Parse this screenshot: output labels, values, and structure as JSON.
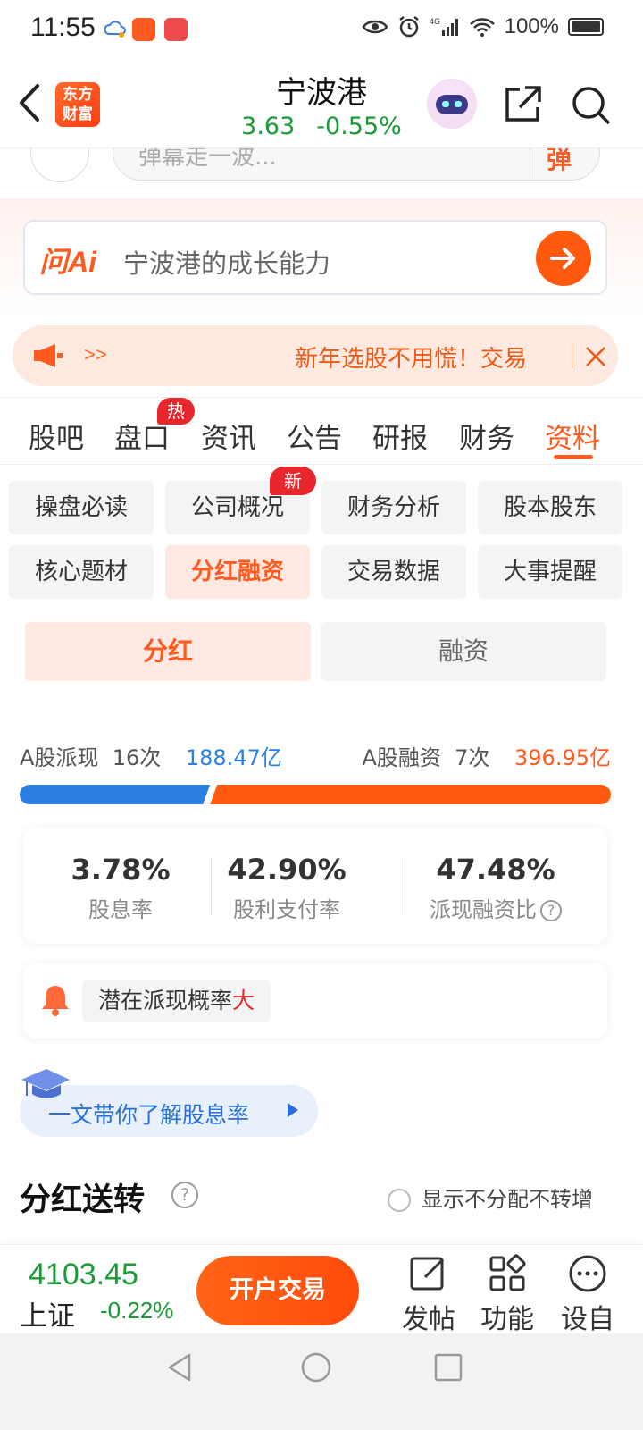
{
  "status_bar": {
    "time": "11:55",
    "battery": "100%"
  },
  "header": {
    "title": "宁波港",
    "price": "3.63",
    "change": "-0.55%",
    "logo_text": "东方\n财富"
  },
  "danmaku": {
    "placeholder": "弹幕走一波..."
  },
  "ai": {
    "logo": "问Ai",
    "query": "宁波港的成长能力"
  },
  "notice": {
    "arrows": ">>",
    "text": "新年选股不用慌！交易"
  },
  "tabs": [
    {
      "label": "股吧"
    },
    {
      "label": "盘口"
    },
    {
      "label": "资讯"
    },
    {
      "label": "公告"
    },
    {
      "label": "研报"
    },
    {
      "label": "财务"
    },
    {
      "label": "资料"
    }
  ],
  "tab_badge_hot": "热",
  "subnav": [
    {
      "label": "操盘必读"
    },
    {
      "label": "公司概况"
    },
    {
      "label": "财务分析"
    },
    {
      "label": "股本股东"
    },
    {
      "label": "核心题材"
    },
    {
      "label": "分红融资"
    },
    {
      "label": "交易数据"
    },
    {
      "label": "大事提醒"
    }
  ],
  "subnav_badge_new": "新",
  "segment": {
    "left": "分红",
    "right": "融资"
  },
  "summary": {
    "dividend_label": "A股派现",
    "dividend_count": "16次",
    "dividend_amount": "188.47亿",
    "financing_label": "A股融资",
    "financing_count": "7次",
    "financing_amount": "396.95亿",
    "dividend_share": 0.322
  },
  "metrics": [
    {
      "value": "3.78%",
      "label": "股息率"
    },
    {
      "value": "42.90%",
      "label": "股利支付率"
    },
    {
      "value": "47.48%",
      "label": "派现融资比"
    }
  ],
  "potential": {
    "prefix": "潜在派现概率",
    "highlight": "大"
  },
  "learn": {
    "text": "一文带你了解股息率"
  },
  "section": {
    "title": "分红送转",
    "option": "显示不分配不转增"
  },
  "bottom": {
    "index_value": "4103.45",
    "index_name": "上证",
    "index_change": "-0.22%",
    "open_button": "开户交易",
    "post": "发帖",
    "func": "功能",
    "settings": "设自"
  },
  "colors": {
    "accent": "#ff5a1f",
    "down": "#1a9b36",
    "blue": "#2a7fe0",
    "hot": "#e8262b"
  }
}
